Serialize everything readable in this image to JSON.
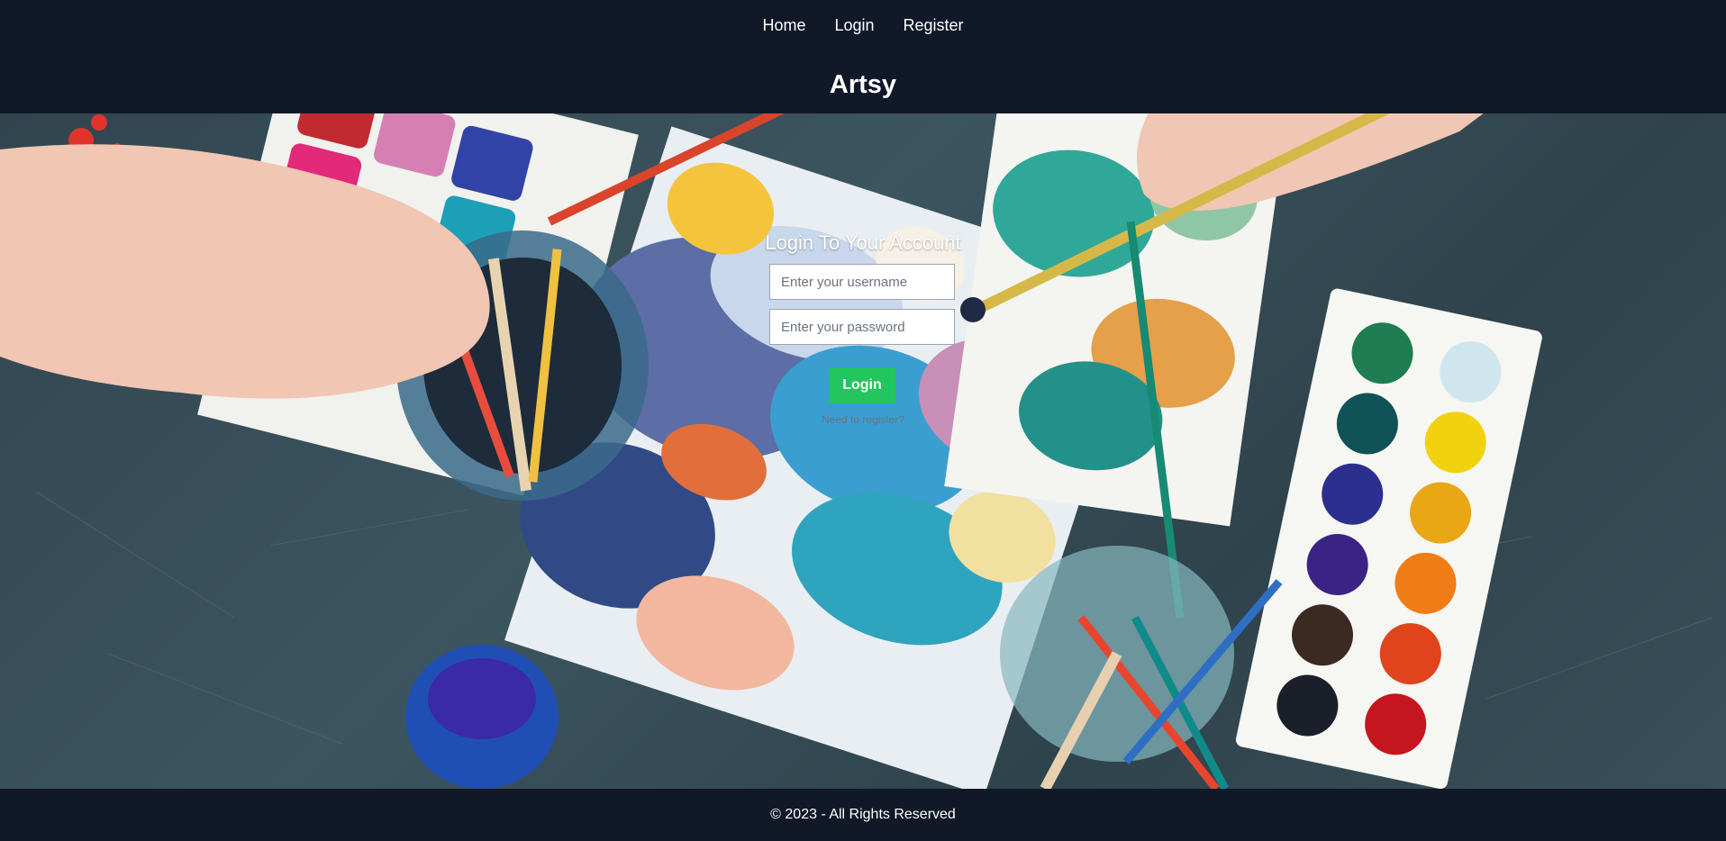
{
  "nav": {
    "items": [
      "Home",
      "Login",
      "Register"
    ]
  },
  "brand": "Artsy",
  "hero": {
    "image": "art-supplies-background",
    "title": "Login To Your Account"
  },
  "form": {
    "username_placeholder": "Enter your username",
    "password_placeholder": "Enter your password",
    "submit_label": "Login",
    "register_link": "Need to register?"
  },
  "footer": {
    "text": "© 2023 - All Rights Reserved"
  },
  "colors": {
    "header_bg": "#111827",
    "button_green": "#22c55e"
  }
}
